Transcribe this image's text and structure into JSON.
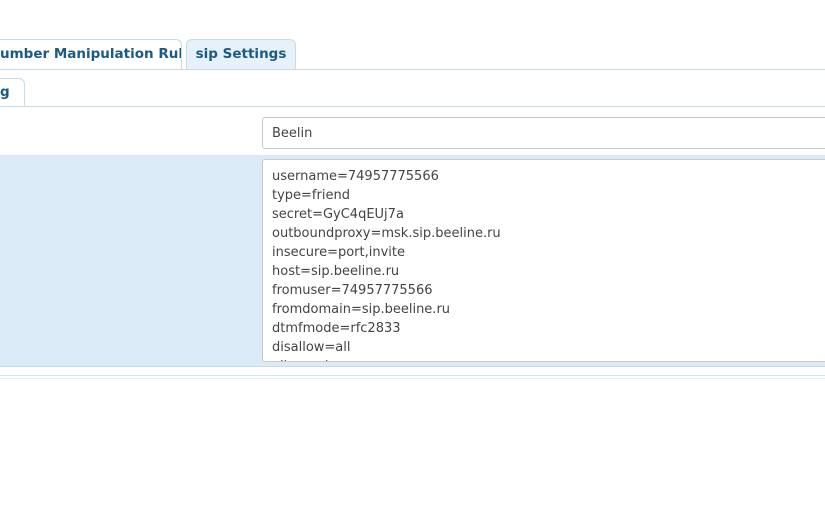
{
  "tabs": {
    "primary": [
      {
        "label": "umber Manipulation Rules"
      },
      {
        "label": "sip Settings"
      }
    ],
    "secondary": [
      {
        "label": "g"
      }
    ]
  },
  "form": {
    "name_value": "Beelin",
    "config_value": "username=74957775566\ntype=friend\nsecret=GyC4qEUj7a\noutboundproxy=msk.sip.beeline.ru\ninsecure=port,invite\nhost=sip.beeline.ru\nfromuser=74957775566\nfromdomain=sip.beeline.ru\ndtmfmode=rfc2833\ndisallow=all\nallow=ulaw"
  },
  "colors": {
    "tab_text": "#1a5b86",
    "active_tab_bg": "#e6f1f9",
    "border": "#c5dbe9",
    "highlight_row": "#dbeaf7"
  }
}
